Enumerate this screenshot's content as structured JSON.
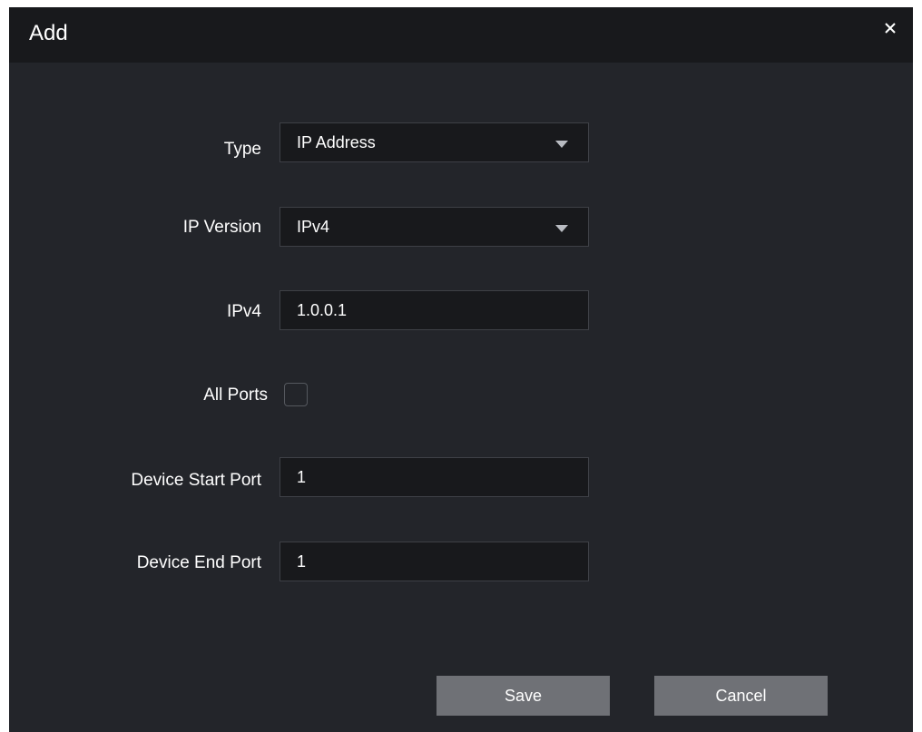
{
  "dialog": {
    "title": "Add",
    "close_icon": "close-icon"
  },
  "form": {
    "type": {
      "label": "Type",
      "value": "IP Address"
    },
    "ip_version": {
      "label": "IP Version",
      "value": "IPv4"
    },
    "ipv4": {
      "label": "IPv4",
      "value": "1.0.0.1"
    },
    "all_ports": {
      "label": "All Ports",
      "checked": false
    },
    "device_start_port": {
      "label": "Device Start Port",
      "value": "1"
    },
    "device_end_port": {
      "label": "Device End Port",
      "value": "1"
    }
  },
  "buttons": {
    "save_label": "Save",
    "cancel_label": "Cancel"
  },
  "colors": {
    "dialog_bg": "#23252a",
    "title_bar_bg": "#18191c",
    "field_bg": "#18191c",
    "button_bg": "#6f7176",
    "text": "#ffffff"
  }
}
